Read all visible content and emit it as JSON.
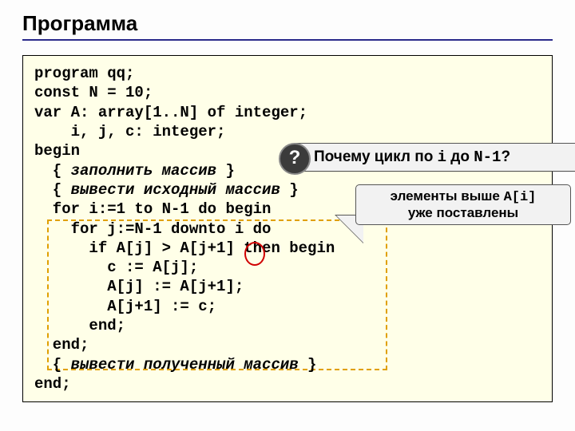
{
  "title": "Программа",
  "code": {
    "l1": "program qq;",
    "l2": "const N = 10;",
    "l3": "var A: array[1..N] of integer;",
    "l4": "    i, j, c: integer;",
    "l5": "begin",
    "l6a": "  { ",
    "l6b": "заполнить массив",
    "l6c": " }",
    "l7a": "  { ",
    "l7b": "вывести исходный массив",
    "l7c": " }",
    "l8": "  for i:=1 to N-1 do begin",
    "l9": "    for j:=N-1 downto i do",
    "l10": "      if A[j] > A[j+1] then begin",
    "l11": "        c := A[j];",
    "l12": "        A[j] := A[j+1];",
    "l13": "        A[j+1] := c;",
    "l14": "      end;",
    "l15": "  end;",
    "l16a": "  { ",
    "l16b": "вывести полученный массив",
    "l16c": " }",
    "l17": "end;"
  },
  "qmark": "?",
  "question": {
    "prefix": "Почему цикл по ",
    "var_i": "i",
    "mid": " до ",
    "expr": "N-1",
    "suffix": "?"
  },
  "tip": {
    "prefix": "элементы выше ",
    "expr": "A[i]",
    "line2": "уже поставлены"
  }
}
